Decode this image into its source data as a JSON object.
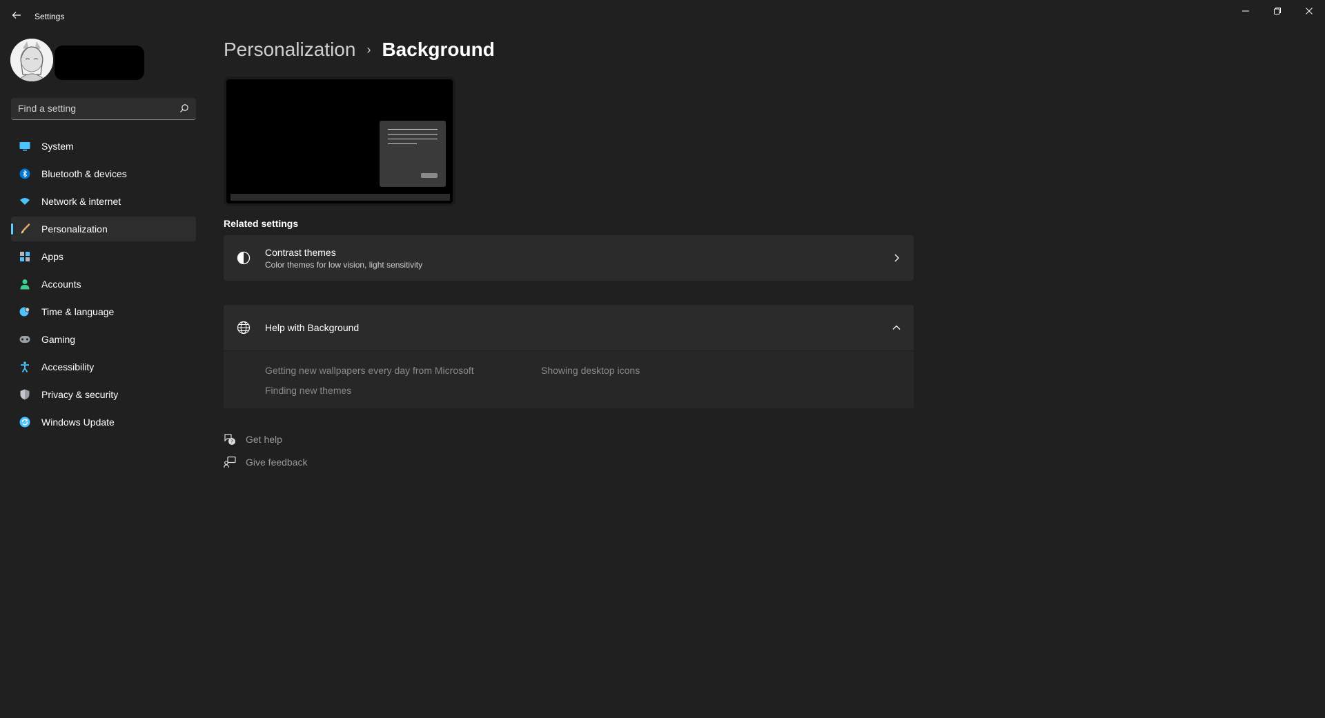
{
  "window": {
    "title": "Settings",
    "minimize_glyph": "—",
    "maximize_glyph": "▢",
    "close_glyph": "✕"
  },
  "search": {
    "placeholder": "Find a setting"
  },
  "sidebar": {
    "items": [
      {
        "label": "System",
        "icon": "monitor-icon",
        "color": "#4cc2ff"
      },
      {
        "label": "Bluetooth & devices",
        "icon": "bluetooth-icon",
        "color": "#0078d4"
      },
      {
        "label": "Network & internet",
        "icon": "wifi-icon",
        "color": "#4cc2ff"
      },
      {
        "label": "Personalization",
        "icon": "brush-icon",
        "color": "#e8a86b",
        "active": true
      },
      {
        "label": "Apps",
        "icon": "apps-icon",
        "color": "#8ab4f8"
      },
      {
        "label": "Accounts",
        "icon": "person-icon",
        "color": "#3ccf91"
      },
      {
        "label": "Time & language",
        "icon": "globe-clock-icon",
        "color": "#4cc2ff"
      },
      {
        "label": "Gaming",
        "icon": "controller-icon",
        "color": "#9aa0a6"
      },
      {
        "label": "Accessibility",
        "icon": "accessibility-icon",
        "color": "#4cc2ff"
      },
      {
        "label": "Privacy & security",
        "icon": "shield-icon",
        "color": "#9aa0a6"
      },
      {
        "label": "Windows Update",
        "icon": "update-icon",
        "color": "#4cc2ff"
      }
    ]
  },
  "breadcrumb": {
    "parent": "Personalization",
    "separator": "›",
    "current": "Background"
  },
  "related": {
    "heading": "Related settings",
    "contrast": {
      "title": "Contrast themes",
      "subtitle": "Color themes for low vision, light sensitivity"
    }
  },
  "help": {
    "title": "Help with Background",
    "links": [
      "Getting new wallpapers every day from Microsoft",
      "Showing desktop icons",
      "Finding new themes"
    ]
  },
  "footer": {
    "get_help": "Get help",
    "give_feedback": "Give feedback"
  },
  "colors": {
    "background": "#202020",
    "card": "#2b2b2b",
    "accent": "#60cdff"
  }
}
